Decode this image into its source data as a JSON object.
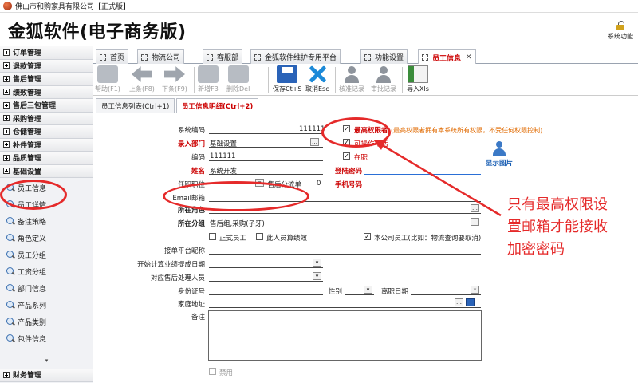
{
  "window": {
    "title": "佛山市和购家具有限公司【正式版】"
  },
  "brand": "金狐软件(电子商务版)",
  "system_function": "系统功能",
  "sidebar": {
    "groups": [
      "订单管理",
      "退款管理",
      "售后管理",
      "绩效管理",
      "售后三包管理",
      "采购管理",
      "仓储管理",
      "补件管理",
      "品质管理",
      "基础设置"
    ],
    "items": [
      "员工信息",
      "员工详情",
      "备注策略",
      "角色定义",
      "员工分组",
      "工资分组",
      "部门信息",
      "产品系列",
      "产品类别",
      "包件信息"
    ],
    "bottom_group": "财务管理"
  },
  "tabs": [
    "首页",
    "物流公司",
    "客服部",
    "金狐软件维护专用平台",
    "功能设置",
    "员工信息"
  ],
  "toolbar": {
    "help": "帮助(F1)",
    "prev": "上条(F8)",
    "next": "下条(F9)",
    "new": "新增F3",
    "delete": "删除Del",
    "save": "保存Ct+S",
    "cancel": "取消Esc",
    "audit": "核准记录",
    "review": "审批记录",
    "export": "导入Xls"
  },
  "subtabs": [
    "员工信息列表(Ctrl+1)",
    "员工信息明细(Ctrl+2)"
  ],
  "form": {
    "sys_code_label": "系统编码",
    "sys_code_value": "111111",
    "dept_label": "录入部门",
    "dept_value": "基础设置",
    "code_label": "编码",
    "code_value": "111111",
    "name_label": "姓名",
    "name_value": "系统开发",
    "position_label": "任职职位",
    "after_sale_label": "售后分流单",
    "after_sale_value": "0",
    "email_label": "Email邮箱",
    "login_pwd_label": "登陆密码",
    "mobile_label": "手机号码",
    "role_label": "所在角色",
    "group_label": "所在分组",
    "group_value": "售后组,采购(子牙)",
    "highest_perm_label": "最高权限者",
    "highest_perm_note": "(最高权限者拥有本系统所有权限，不受任何权限控制)",
    "operable_label": "可操作电话",
    "employed_label": "在职",
    "regular_label": "正式员工",
    "counted_label": "此人员算绩效",
    "company_emp_label": "本公司员工(比如：物流查询要取消)",
    "platform_nick_label": "接单平台昵称",
    "commission_date_label": "开始计算业绩提成日期",
    "after_sale_handler_label": "对应售后处理人员",
    "id_label": "身份证号",
    "gender_label": "性别",
    "leave_date_label": "离职日期",
    "address_label": "家庭地址",
    "remark_label": "备注",
    "disabled_label": "禁用",
    "photo_label": "显示图片"
  },
  "annotation": {
    "line1": "只有最高权限设",
    "line2": "置邮箱才能接收",
    "line3": "加密密码",
    "color": "#e52a2a"
  }
}
